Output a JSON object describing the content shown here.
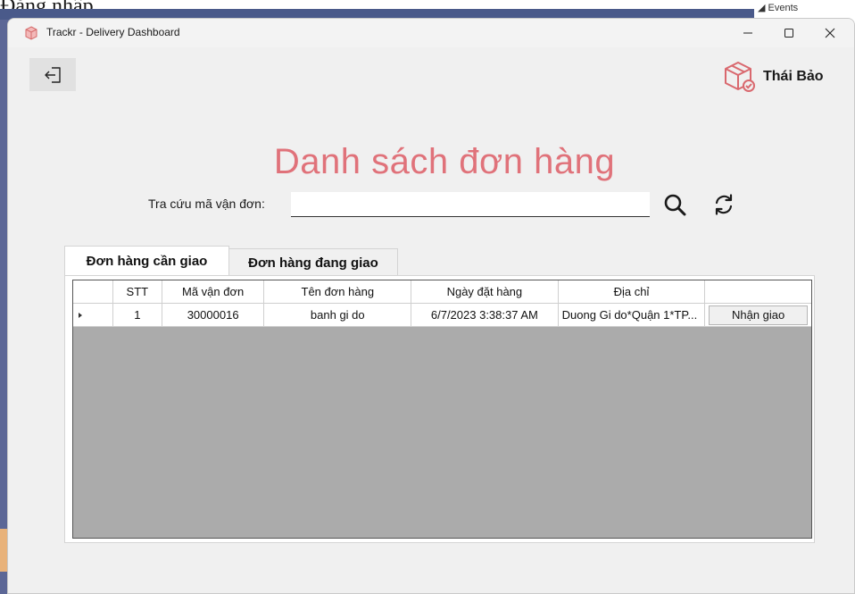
{
  "background": {
    "top_text": "Đăng nhập",
    "events_label": "◢ Events"
  },
  "window": {
    "title": "Trackr - Delivery Dashboard",
    "controls": {
      "minimize": "—",
      "maximize": "☐",
      "close": "✕"
    }
  },
  "user": {
    "name": "Thái Bảo"
  },
  "page_title": "Danh sách đơn hàng",
  "search": {
    "label": "Tra cứu mã vận đơn:",
    "value": "",
    "placeholder": ""
  },
  "tabs": [
    {
      "label": "Đơn hàng cần giao",
      "active": true
    },
    {
      "label": "Đơn hàng đang giao",
      "active": false
    }
  ],
  "table": {
    "columns": [
      "",
      "STT",
      "Mã vận đơn",
      "Tên đơn hàng",
      "Ngày đặt hàng",
      "Địa chỉ",
      ""
    ],
    "rows": [
      {
        "stt": "1",
        "code": "30000016",
        "name": "banh gi do",
        "date": "6/7/2023 3:38:37 AM",
        "address": "Duong Gi do*Quận 1*TP...",
        "action": "Nhận giao"
      }
    ]
  },
  "colors": {
    "accent_title": "#e0727a",
    "grid_empty": "#ababab",
    "sidebar": "#5c6796"
  }
}
